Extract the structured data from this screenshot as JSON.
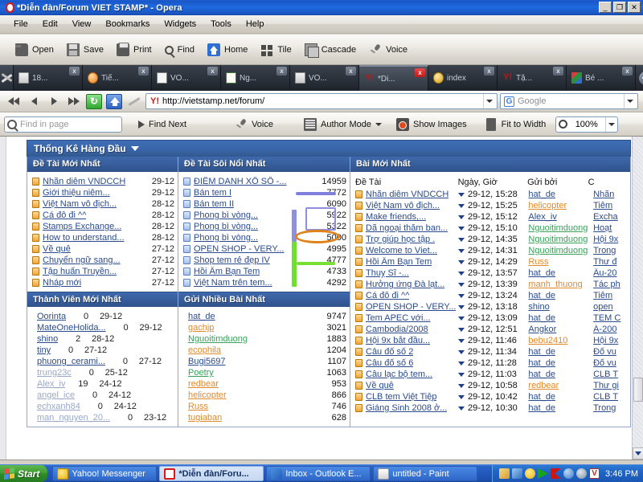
{
  "window": {
    "title": "*Diễn đàn/Forum VIET STAMP* - Opera",
    "minimize": "_",
    "maximize": "❐",
    "close": "✕"
  },
  "menu": [
    "File",
    "Edit",
    "View",
    "Bookmarks",
    "Widgets",
    "Tools",
    "Help"
  ],
  "toolbar": [
    {
      "label": "Open",
      "icon": "folder-icon"
    },
    {
      "label": "Save",
      "icon": "floppy-disk-icon"
    },
    {
      "label": "Print",
      "icon": "printer-icon"
    },
    {
      "label": "Find",
      "icon": "magnifier-icon"
    },
    {
      "label": "Home",
      "icon": "home-icon"
    },
    {
      "label": "Tile",
      "icon": "tile-windows-icon"
    },
    {
      "label": "Cascade",
      "icon": "cascade-windows-icon"
    },
    {
      "label": "Voice",
      "icon": "microphone-icon"
    }
  ],
  "tabs": [
    {
      "label": "18...",
      "icon": "page-icon",
      "active": false
    },
    {
      "label": "Tiế...",
      "icon": "orange-ball-icon",
      "active": false
    },
    {
      "label": "VO...",
      "icon": "text-page-icon",
      "active": false
    },
    {
      "label": "Ng...",
      "icon": "green-doc-icon",
      "active": false
    },
    {
      "label": "VO...",
      "icon": "page-icon",
      "active": false
    },
    {
      "label": "*Di...",
      "icon": "yahoo-icon",
      "active": true
    },
    {
      "label": "index",
      "icon": "gold-ball-icon",
      "active": false
    },
    {
      "label": "Tậ...",
      "icon": "yahoo-icon",
      "active": false
    },
    {
      "label": "Bé ...",
      "icon": "chart-icon",
      "active": false
    }
  ],
  "tab_close_label": "x",
  "address": {
    "url": "http://vietstamp.net/forum/",
    "favicon": "yahoo-icon",
    "search_placeholder": "Google",
    "search_engine_icon": "google-icon"
  },
  "findbar": {
    "find_placeholder": "Find in page",
    "find_next": "Find Next",
    "voice": "Voice",
    "author_mode": "Author Mode",
    "show_images": "Show Images",
    "fit_to_width": "Fit to Width",
    "zoom": "100%"
  },
  "page": {
    "stats_header": "Thống Kê Hàng Đầu",
    "panels": {
      "newest_topics": {
        "title": "Đề Tài Mới Nhất",
        "rows": [
          {
            "title": "Nhãn diêm VNDCCH",
            "date": "29-12"
          },
          {
            "title": "Giới thiệu niêm...",
            "date": "29-12"
          },
          {
            "title": "Việt Nam vô địch...",
            "date": "28-12"
          },
          {
            "title": "Cá đô đi ^^",
            "date": "28-12"
          },
          {
            "title": "Stamps Exchange...",
            "date": "28-12"
          },
          {
            "title": "How to understand...",
            "date": "28-12"
          },
          {
            "title": "Về quê",
            "date": "27-12"
          },
          {
            "title": "Chuyển ngữ sang...",
            "date": "27-12"
          },
          {
            "title": "Tập huấn Truyền...",
            "date": "27-12"
          },
          {
            "title": "Nháp mới",
            "date": "27-12"
          }
        ]
      },
      "hottest_topics": {
        "title": "Đề Tài Sôi Nổi Nhất",
        "rows": [
          {
            "title": "ĐIỂM DANH XỔ SỐ -...",
            "count": "14959"
          },
          {
            "title": "Bán tem I",
            "count": "7772"
          },
          {
            "title": "Bán tem II",
            "count": "6090"
          },
          {
            "title": "Phong bì vòng...",
            "count": "5922"
          },
          {
            "title": "Phong bì vòng...",
            "count": "5322"
          },
          {
            "title": "Phong bì vòng...",
            "count": "5000"
          },
          {
            "title": "OPEN SHOP - VERY...",
            "count": "4995"
          },
          {
            "title": "Shop tem rẻ đẹp IV",
            "count": "4777"
          },
          {
            "title": "Hồi Âm Bạn Tem",
            "count": "4733"
          },
          {
            "title": "Việt Nam trên tem...",
            "count": "4292"
          }
        ]
      },
      "newest_members": {
        "title": "Thành Viên Mới Nhất",
        "rows": [
          {
            "name": "Oorinta",
            "posts": "0",
            "date": "29-12",
            "dim": false
          },
          {
            "name": "MateOneHolida...",
            "posts": "0",
            "date": "29-12",
            "dim": false
          },
          {
            "name": "shino",
            "posts": "2",
            "date": "28-12",
            "dim": false
          },
          {
            "name": "tiny",
            "posts": "0",
            "date": "27-12",
            "dim": false
          },
          {
            "name": "phuong_cerami...",
            "posts": "0",
            "date": "27-12",
            "dim": false
          },
          {
            "name": "trung23c",
            "posts": "0",
            "date": "25-12",
            "dim": true
          },
          {
            "name": "Alex_iv",
            "posts": "19",
            "date": "24-12",
            "dim": true
          },
          {
            "name": "angel_ice",
            "posts": "0",
            "date": "24-12",
            "dim": true
          },
          {
            "name": "echxanh84",
            "posts": "0",
            "date": "24-12",
            "dim": true
          },
          {
            "name": "man_nguyen_20...",
            "posts": "0",
            "date": "23-12",
            "dim": true
          }
        ]
      },
      "most_posts": {
        "title": "Gửi Nhiều Bài Nhất",
        "rows": [
          {
            "name": "hat_de",
            "count": "9747",
            "color": "blue"
          },
          {
            "name": "gachjp",
            "count": "3021",
            "color": "orange"
          },
          {
            "name": "Nguoitimduong",
            "count": "1883",
            "color": "green"
          },
          {
            "name": "ecophila",
            "count": "1204",
            "color": "orange"
          },
          {
            "name": "Bugi5697",
            "count": "1107",
            "color": "blue"
          },
          {
            "name": "Poetry",
            "count": "1063",
            "color": "green"
          },
          {
            "name": "redbear",
            "count": "953",
            "color": "orange"
          },
          {
            "name": "helicopter",
            "count": "866",
            "color": "orange"
          },
          {
            "name": "Russ",
            "count": "746",
            "color": "orange"
          },
          {
            "name": "tugiaban",
            "count": "628",
            "color": "orange"
          }
        ]
      },
      "latest_posts": {
        "title": "Bài Mới Nhất",
        "columns": [
          "Đề Tài",
          "Ngày, Giờ",
          "Gửi bởi",
          "C"
        ],
        "rows": [
          {
            "title": "Nhãn diêm VNDCCH",
            "datetime": "29-12, 15:28",
            "author": "hat_de",
            "author_color": "blue",
            "forum": "Nhãn "
          },
          {
            "title": "Việt Nam vô địch...",
            "datetime": "29-12, 15:25",
            "author": "helicopter",
            "author_color": "orange",
            "forum": "Tiêm "
          },
          {
            "title": "Make friends,...",
            "datetime": "29-12, 15:12",
            "author": "Alex_iv",
            "author_color": "blue",
            "forum": "Excha"
          },
          {
            "title": "Dã ngoại thăm ban...",
            "datetime": "29-12, 15:10",
            "author": "Nguoitimduong",
            "author_color": "green",
            "forum": "Hoạt "
          },
          {
            "title": "Trợ giúp học tập .",
            "datetime": "29-12, 14:35",
            "author": "Nguoitimduong",
            "author_color": "green",
            "forum": "Hội 9x"
          },
          {
            "title": "Welcome to Viet...",
            "datetime": "29-12, 14:31",
            "author": "Nguoitimduong",
            "author_color": "green",
            "forum": "Trong"
          },
          {
            "title": "Hồi Âm Bạn Tem",
            "datetime": "29-12, 14:29",
            "author": "Russ",
            "author_color": "orange",
            "forum": "Thư đ"
          },
          {
            "title": "Thuỵ Sĩ -...",
            "datetime": "29-12, 13:57",
            "author": "hat_de",
            "author_color": "blue",
            "forum": "Âu-20"
          },
          {
            "title": "Hưởng ứng Đà lạt...",
            "datetime": "29-12, 13:39",
            "author": "manh_thuong",
            "author_color": "orange",
            "forum": "Tác ph"
          },
          {
            "title": "Cá đô đi ^^",
            "datetime": "29-12, 13:24",
            "author": "hat_de",
            "author_color": "blue",
            "forum": "Tiêm "
          },
          {
            "title": "OPEN SHOP - VERY...",
            "datetime": "29-12, 13:18",
            "author": "shino",
            "author_color": "blue",
            "forum": "open"
          },
          {
            "title": "Tem APEC với...",
            "datetime": "29-12, 13:09",
            "author": "hat_de",
            "author_color": "blue",
            "forum": "TEM C"
          },
          {
            "title": "Cambodia/2008",
            "datetime": "29-12, 12:51",
            "author": "Angkor",
            "author_color": "blue",
            "forum": "Á-200"
          },
          {
            "title": "Hội 9x bắt đầu...",
            "datetime": "29-12, 11:46",
            "author": "bebu2410",
            "author_color": "orange",
            "forum": "Hội 9x"
          },
          {
            "title": "Câu đố số 2",
            "datetime": "29-12, 11:34",
            "author": "hat_de",
            "author_color": "blue",
            "forum": "Đố vu"
          },
          {
            "title": "Câu đố số 6",
            "datetime": "29-12, 11:28",
            "author": "hat_de",
            "author_color": "blue",
            "forum": "Đố vu"
          },
          {
            "title": "Câu lạc bộ tem...",
            "datetime": "29-12, 11:03",
            "author": "hat_de",
            "author_color": "blue",
            "forum": "CLB T"
          },
          {
            "title": "Về quê",
            "datetime": "29-12, 10:58",
            "author": "redbear",
            "author_color": "orange",
            "forum": "Thư gi"
          },
          {
            "title": "CLB tem Việt Tiệp",
            "datetime": "29-12, 10:42",
            "author": "hat_de",
            "author_color": "blue",
            "forum": "CLB T"
          },
          {
            "title": "Giáng Sinh 2008 ở...",
            "datetime": "29-12, 10:30",
            "author": "hat_de",
            "author_color": "blue",
            "forum": "Trong"
          }
        ]
      }
    }
  },
  "annotations": {
    "ellipse_color": "#e0821a",
    "rect_color": "#8f8fdd",
    "bar_blue": "#8f8fe0",
    "bar_green": "#6ee02e"
  },
  "taskbar": {
    "start": "Start",
    "items": [
      {
        "label": "Yahoo! Messenger",
        "icon": "yahoo-messenger-icon",
        "active": false
      },
      {
        "label": "*Diễn đàn/Foru...",
        "icon": "opera-icon",
        "active": true
      },
      {
        "label": "Inbox - Outlook E...",
        "icon": "outlook-icon",
        "active": false
      },
      {
        "label": "untitled - Paint",
        "icon": "paint-icon",
        "active": false
      }
    ],
    "tray_icons": [
      "mail-icon",
      "network-icon",
      "smiley-icon",
      "media-play-icon",
      "kaspersky-icon",
      "globe-icon",
      "disc-icon",
      "v-icon"
    ],
    "clock": "3:46 PM"
  }
}
